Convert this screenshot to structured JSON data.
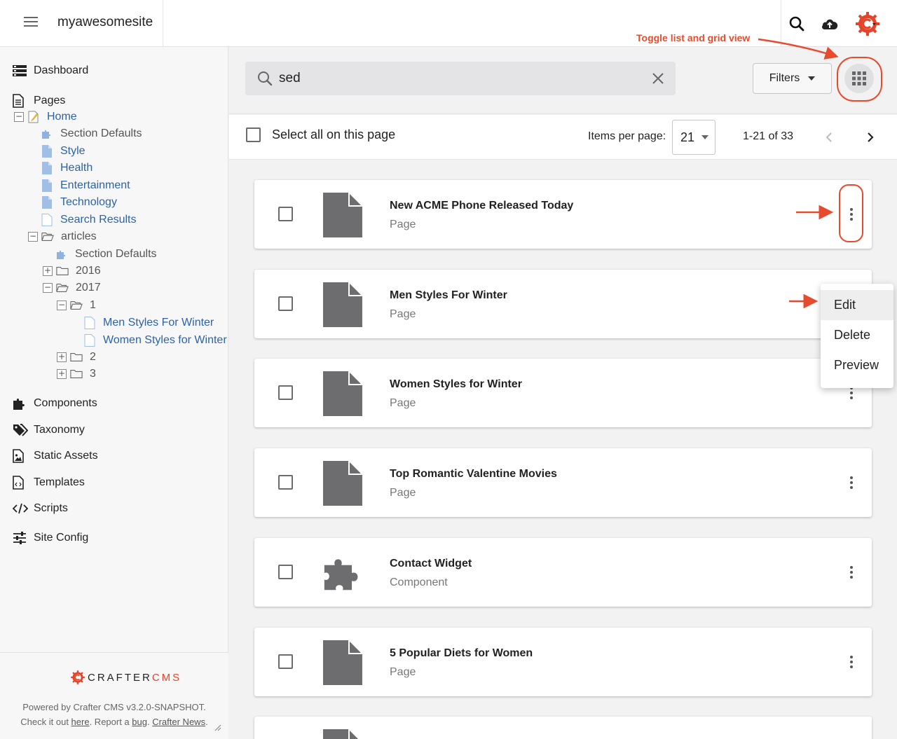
{
  "header": {
    "site_name": "myawesomesite",
    "icons": [
      "menu-icon",
      "search-icon",
      "cloud-upload-icon",
      "crafter-logo-icon"
    ]
  },
  "sidebar": {
    "dashboard": "Dashboard",
    "pages": "Pages",
    "tree": {
      "home": "Home",
      "section_defaults": "Section Defaults",
      "style": "Style",
      "health": "Health",
      "entertainment": "Entertainment",
      "technology": "Technology",
      "search_results": "Search Results",
      "articles": "articles",
      "articles_section_defaults": "Section Defaults",
      "y2016": "2016",
      "y2017": "2017",
      "f1": "1",
      "men_styles": "Men Styles For Winter",
      "women_styles": "Women Styles for Winter",
      "f2": "2",
      "f3": "3"
    },
    "components": "Components",
    "taxonomy": "Taxonomy",
    "static_assets": "Static Assets",
    "templates": "Templates",
    "scripts": "Scripts",
    "site_config": "Site Config"
  },
  "footer": {
    "logo_main": "CRAFTER",
    "logo_cms": "CMS",
    "powered_by": "Powered by Crafter CMS v3.2.0-SNAPSHOT.",
    "check_prefix": "Check it out ",
    "here": "here",
    "report_prefix": ". Report a ",
    "bug": "bug",
    "sep": ". ",
    "news": "Crafter News",
    "end": "."
  },
  "search": {
    "value": "sed",
    "filters_label": "Filters"
  },
  "selection": {
    "select_all_label": "Select all on this page",
    "items_per_page_label": "Items per page:",
    "items_per_page_value": "21",
    "range": "1-21 of 33"
  },
  "results": [
    {
      "title": "New ACME Phone Released Today",
      "type": "Page",
      "icon": "page-icon"
    },
    {
      "title": "Men Styles For Winter",
      "type": "Page",
      "icon": "page-icon"
    },
    {
      "title": "Women Styles for Winter",
      "type": "Page",
      "icon": "page-icon"
    },
    {
      "title": "Top Romantic Valentine Movies",
      "type": "Page",
      "icon": "page-icon"
    },
    {
      "title": "Contact Widget",
      "type": "Component",
      "icon": "puzzle-icon"
    },
    {
      "title": "5 Popular Diets for Women",
      "type": "Page",
      "icon": "page-icon"
    }
  ],
  "context_menu": {
    "items": [
      "Edit",
      "Delete",
      "Preview"
    ]
  },
  "annotation": {
    "toggle_text": "Toggle list and grid view"
  },
  "colors": {
    "accent": "#e64b2d",
    "link": "#2c63a8",
    "tree_page_icon": "#9fbfe6"
  }
}
